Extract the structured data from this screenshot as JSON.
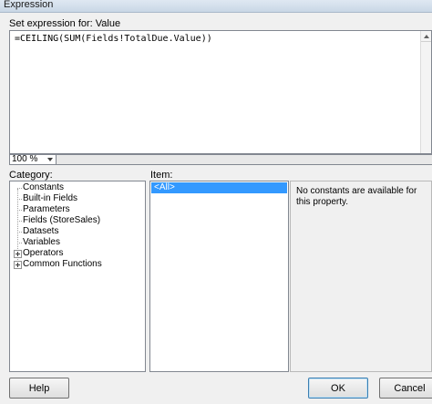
{
  "window": {
    "title": "Expression"
  },
  "expression": {
    "label": "Set expression for: Value",
    "value": "=CEILING(SUM(Fields!TotalDue.Value))",
    "zoom": "100 %"
  },
  "category": {
    "label": "Category:",
    "items": [
      {
        "label": "Constants",
        "expandable": false
      },
      {
        "label": "Built-in Fields",
        "expandable": false
      },
      {
        "label": "Parameters",
        "expandable": false
      },
      {
        "label": "Fields (StoreSales)",
        "expandable": false
      },
      {
        "label": "Datasets",
        "expandable": false
      },
      {
        "label": "Variables",
        "expandable": false
      },
      {
        "label": "Operators",
        "expandable": true
      },
      {
        "label": "Common Functions",
        "expandable": true
      }
    ]
  },
  "item": {
    "label": "Item:",
    "selected": "<All>"
  },
  "description": {
    "text": "No constants are available for this property."
  },
  "buttons": {
    "help": "Help",
    "ok": "OK",
    "cancel": "Cancel"
  },
  "colors": {
    "selection": "#3399ff",
    "background": "#f0f0f0"
  }
}
